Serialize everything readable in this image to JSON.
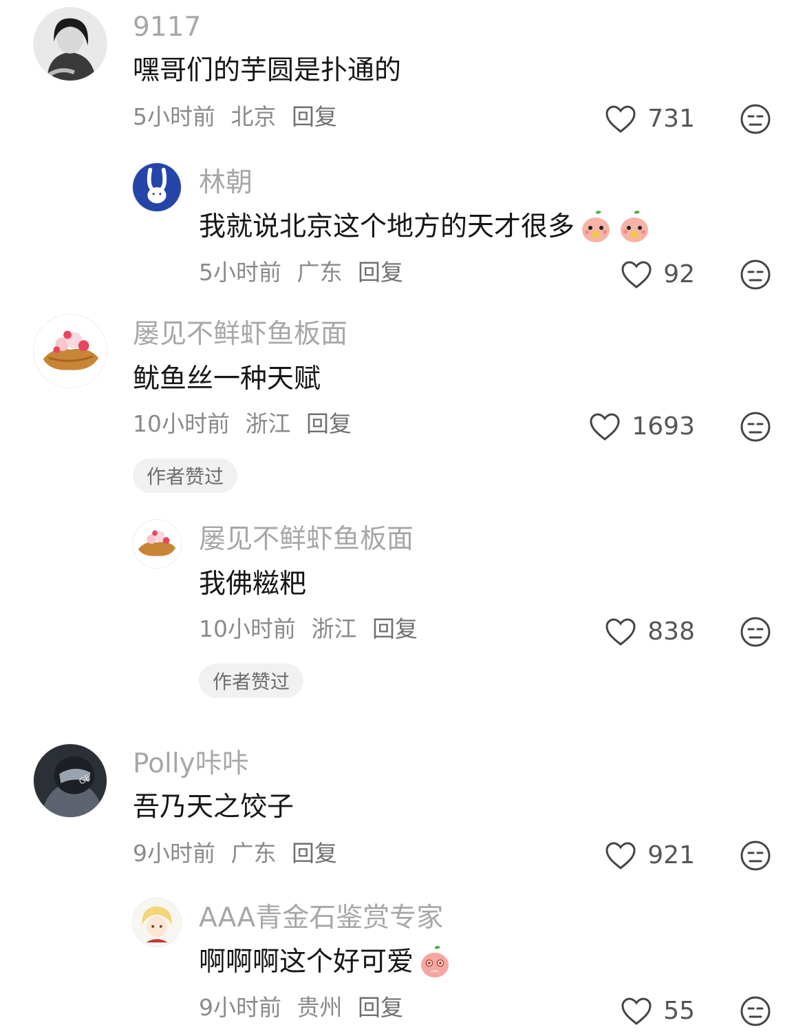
{
  "comments": [
    {
      "username": "9117",
      "text": "嘿哥们的芋圆是扑通的",
      "time": "5小时前",
      "location": "北京",
      "reply_label": "回复",
      "likes": "731"
    },
    {
      "username": "林朝",
      "text": "我就说北京这个地方的天才很多",
      "time": "5小时前",
      "location": "广东",
      "reply_label": "回复",
      "likes": "92",
      "emojis": [
        "cute-peach-emoji",
        "cute-peach-emoji"
      ]
    },
    {
      "username": "屡见不鲜虾鱼板面",
      "text": "鱿鱼丝一种天赋",
      "time": "10小时前",
      "location": "浙江",
      "reply_label": "回复",
      "likes": "1693",
      "badge": "作者赞过"
    },
    {
      "username": "屡见不鲜虾鱼板面",
      "text": "我佛糍粑",
      "time": "10小时前",
      "location": "浙江",
      "reply_label": "回复",
      "likes": "838",
      "badge": "作者赞过"
    },
    {
      "username": "Polly咔咔",
      "text": "吾乃天之饺子",
      "time": "9小时前",
      "location": "广东",
      "reply_label": "回复",
      "likes": "921"
    },
    {
      "username": "AAA青金石鉴赏专家",
      "text": "啊啊啊这个好可爱",
      "time": "9小时前",
      "location": "贵州",
      "reply_label": "回复",
      "likes": "55",
      "emojis": [
        "teary-peach-emoji"
      ]
    }
  ],
  "colors": {
    "username": "#a7a7a7",
    "text": "#161616",
    "meta": "#8a8a8a",
    "badge_bg": "#f1f1f1"
  }
}
